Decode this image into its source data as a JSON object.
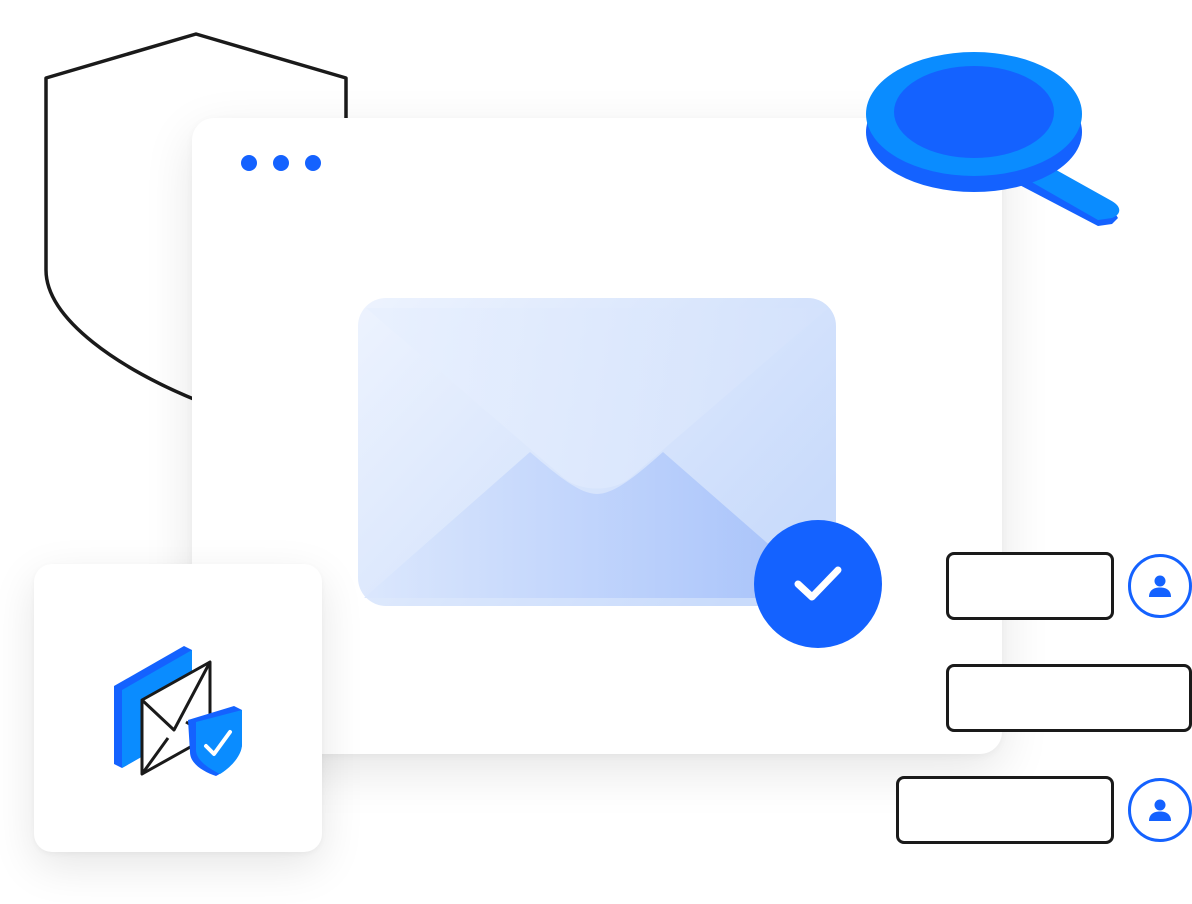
{
  "colors": {
    "accent": "#1462ff",
    "accent_light": "#0a8cff",
    "outline": "#1a1a1a",
    "envelope_light": "#e9f0fd",
    "envelope_mid": "#c5d8fb",
    "envelope_dark": "#a9c4fa"
  },
  "icons": {
    "shield_outline": "shield-outline-icon",
    "window_dots": "window-dots",
    "envelope": "envelope-icon",
    "check": "check-icon",
    "magnifier": "magnifier-icon",
    "secure_mail": "secure-mail-icon",
    "user": "user-icon"
  },
  "window": {
    "dot_count": 3
  },
  "form": {
    "fields": [
      {
        "value": "",
        "has_avatar": true
      },
      {
        "value": "",
        "has_avatar": false
      },
      {
        "value": "",
        "has_avatar": true
      }
    ]
  }
}
